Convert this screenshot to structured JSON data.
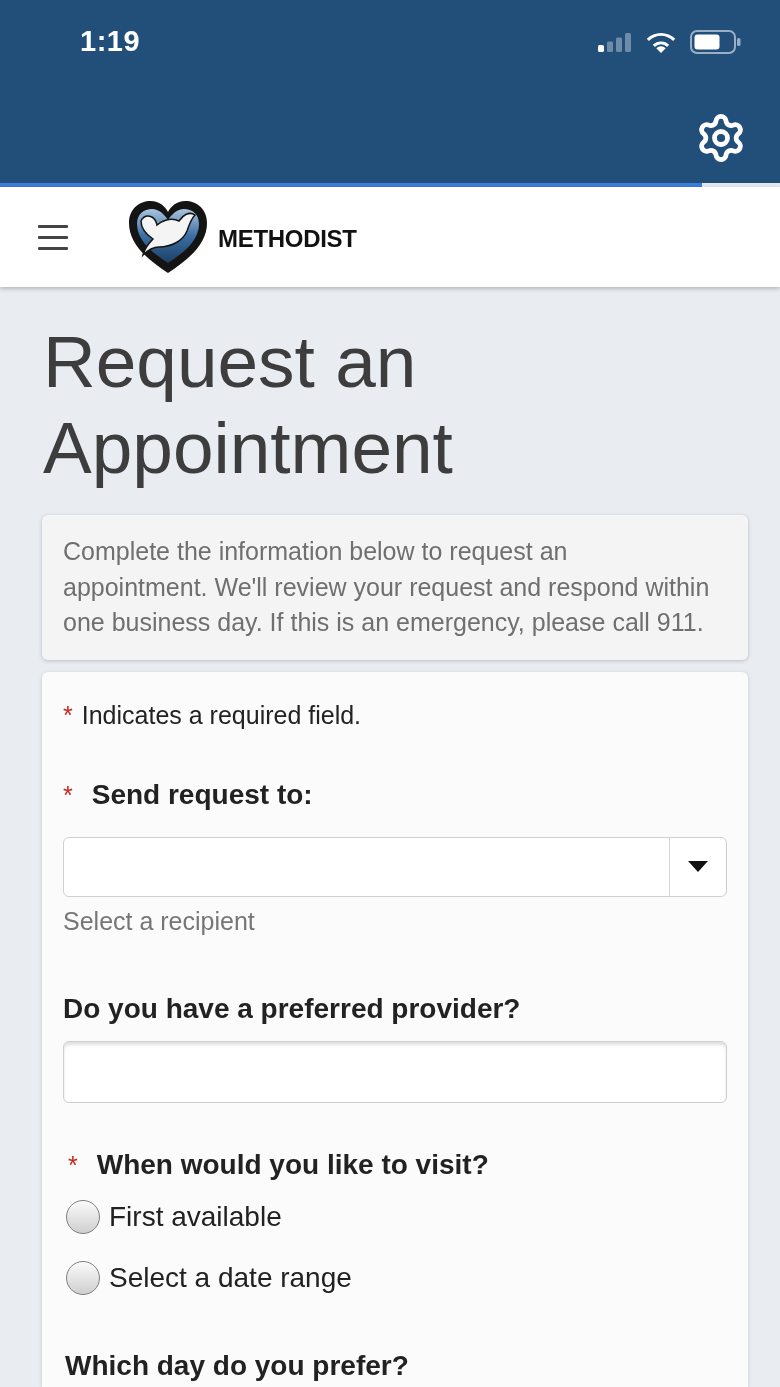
{
  "status_bar": {
    "time": "1:19"
  },
  "loading_bar": {
    "level": 0.9
  },
  "header": {
    "brand": "METHODIST"
  },
  "title": "Request an Appointment",
  "intro": "Complete the information below to request an appointment. We'll review your request and respond within one business day. If this is an emergency, please call 911.",
  "form": {
    "required_note": {
      "marker": "*",
      "text": "Indicates a required field."
    },
    "fields": [
      {
        "kind": "select",
        "marker": "*",
        "label": "Send request to:",
        "help_text": "Select a recipient"
      },
      {
        "kind": "text",
        "label": "Do you have a preferred provider?"
      },
      {
        "kind": "radio",
        "marker": "*",
        "label": "When would you like to visit?",
        "options": [
          {
            "label": "First available",
            "selected": false
          },
          {
            "label": "Select a date range",
            "selected": false
          }
        ]
      },
      {
        "kind": "heading",
        "label": "Which day do you prefer?"
      }
    ]
  }
}
